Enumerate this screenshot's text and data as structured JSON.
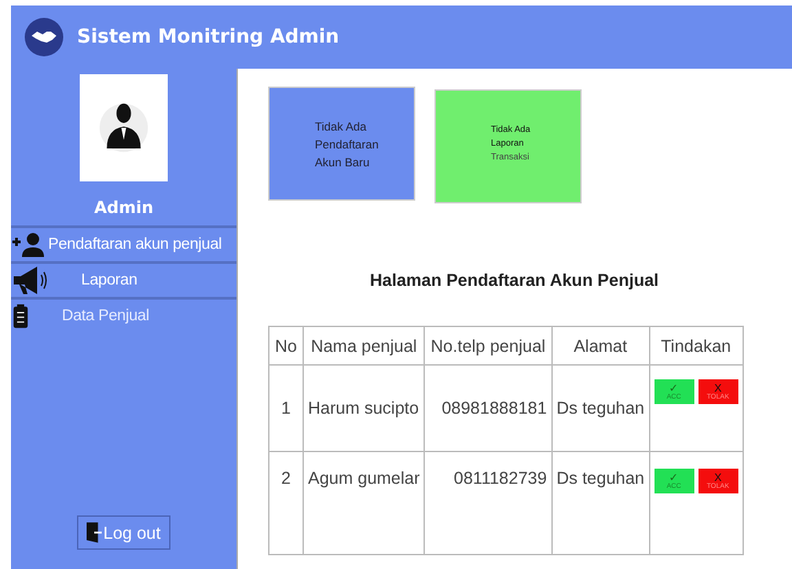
{
  "header": {
    "title": "Sistem Monitring Admin"
  },
  "sidebar": {
    "user": "Admin",
    "items": [
      {
        "label": "Pendaftaran akun penjual",
        "kind": "add-user"
      },
      {
        "label": "Laporan",
        "kind": "megaphone"
      },
      {
        "label": "Data Penjual",
        "kind": "clipboard"
      }
    ],
    "logout": "Log out"
  },
  "cards": [
    {
      "lines": [
        "Tidak Ada",
        "Pendaftaran",
        "Akun Baru"
      ],
      "color": "#6b8cee"
    },
    {
      "lines": [
        "Tidak Ada",
        "Laporan",
        "Transaksi"
      ],
      "color": "#70ee6e"
    }
  ],
  "heading": "Halaman Pendaftaran Akun Penjual",
  "table": {
    "columns": [
      "No",
      "Nama penjual",
      "No.telp penjual",
      "Alamat",
      "Tindakan"
    ],
    "rows": [
      {
        "no": "1",
        "name": "Harum sucipto",
        "phone": "08981888181",
        "address": "Ds teguhan",
        "actions": [
          {
            "kind": "accept",
            "symbol": "✓",
            "label": "ACC"
          },
          {
            "kind": "reject",
            "symbol": "X",
            "label": "TOLAK"
          }
        ]
      },
      {
        "no": "2",
        "name": "Agum gumelar",
        "phone": "0811182739",
        "address": "Ds teguhan",
        "actions": [
          {
            "kind": "accept",
            "symbol": "✓",
            "label": "ACC"
          },
          {
            "kind": "reject",
            "symbol": "X",
            "label": "TOLAK"
          }
        ]
      }
    ]
  }
}
